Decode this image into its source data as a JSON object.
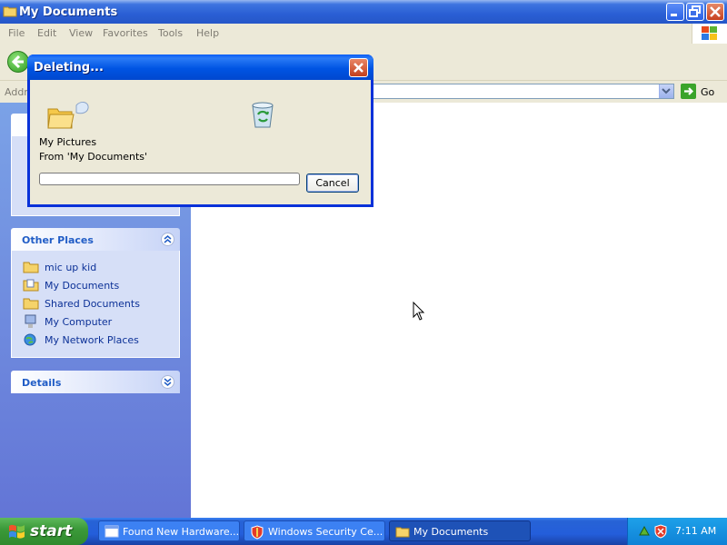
{
  "window": {
    "title": "My Documents"
  },
  "menu": [
    "File",
    "Edit",
    "View",
    "Favorites",
    "Tools",
    "Help"
  ],
  "address": {
    "label": "Addr",
    "go_label": "Go"
  },
  "other_places": {
    "title": "Other Places",
    "items": [
      "mic up kid",
      "My Documents",
      "Shared Documents",
      "My Computer",
      "My Network Places"
    ]
  },
  "details": {
    "title": "Details"
  },
  "dialog": {
    "title": "Deleting...",
    "item_name": "My Pictures",
    "item_from": "From 'My Documents'",
    "cancel_label": "Cancel",
    "progress_fraction": 0
  },
  "taskbar": {
    "start_label": "start",
    "tasks": [
      "Found New Hardware...",
      "Windows Security Ce...",
      "My Documents"
    ],
    "clock": "7:11 AM"
  },
  "colors": {
    "xp_blue": "#0054e3",
    "panel_blue": "#6375d6",
    "link_blue": "#0c3197"
  }
}
